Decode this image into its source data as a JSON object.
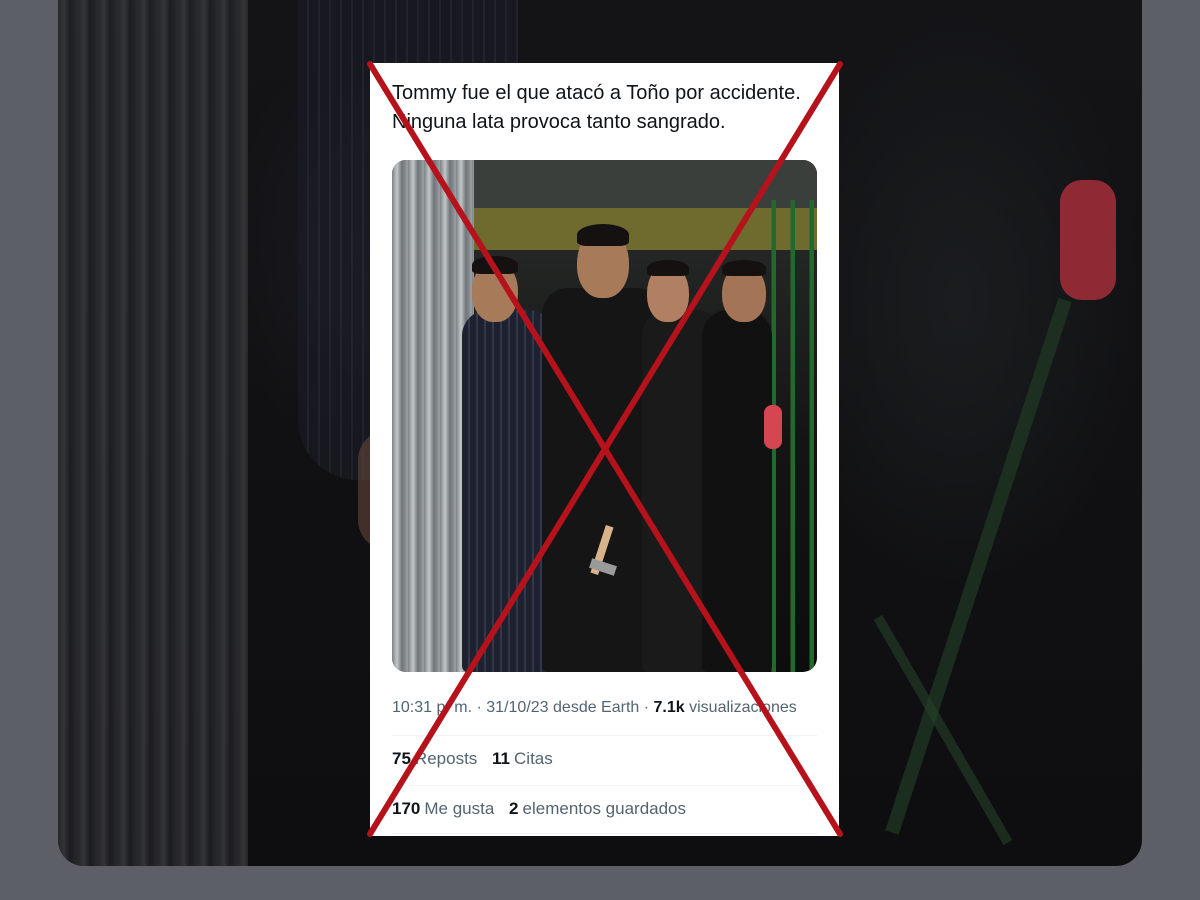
{
  "tweet": {
    "text_lines": [
      "Tommy fue el que atacó a Toño por accidente.",
      "Ninguna lata provoca tanto sangrado."
    ],
    "meta": {
      "time": "10:31 p. m.",
      "separator": "·",
      "date": "31/10/23",
      "source": "desde Earth",
      "views_count": "7.1k",
      "views_label": "visualizaciones"
    },
    "stats": {
      "reposts_count": "75",
      "reposts_label": "Reposts",
      "quotes_count": "11",
      "quotes_label": "Citas",
      "likes_count": "170",
      "likes_label": "Me gusta",
      "bookmarks_count": "2",
      "bookmarks_label": "elementos guardados"
    }
  },
  "overlay": {
    "type": "red-x-strikethrough",
    "color": "#b5121b"
  },
  "colors": {
    "backdrop": "#5d5f66",
    "card": "#ffffff",
    "text_primary": "#0f1419",
    "text_secondary": "#536471"
  }
}
